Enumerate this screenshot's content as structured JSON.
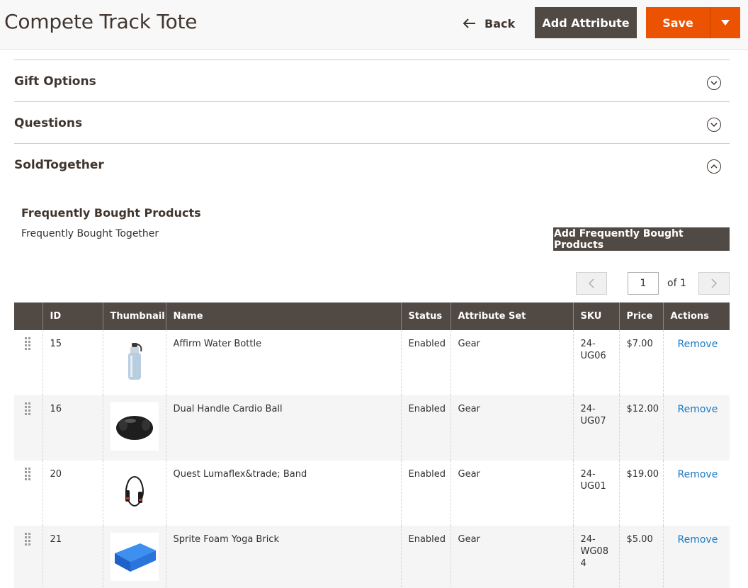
{
  "header": {
    "title": "Compete Track Tote",
    "back_label": "Back",
    "add_attribute_label": "Add Attribute",
    "save_label": "Save"
  },
  "sections": [
    {
      "title": "Gift Options",
      "state": "collapsed"
    },
    {
      "title": "Questions",
      "state": "collapsed"
    },
    {
      "title": "SoldTogether",
      "state": "expanded"
    }
  ],
  "sold_together": {
    "heading": "Frequently Bought Products",
    "subtext": "Frequently Bought Together",
    "add_button_label": "Add Frequently Bought Products"
  },
  "pager": {
    "current_page": "1",
    "of_label": "of 1"
  },
  "table": {
    "columns": [
      "",
      "ID",
      "Thumbnail",
      "Name",
      "Status",
      "Attribute Set",
      "SKU",
      "Price",
      "Actions"
    ],
    "rows": [
      {
        "id": "15",
        "thumbnail": "water-bottle",
        "name": "Affirm Water Bottle",
        "status": "Enabled",
        "attribute_set": "Gear",
        "sku": "24-UG06",
        "price": "$7.00",
        "action": "Remove"
      },
      {
        "id": "16",
        "thumbnail": "cardio-ball",
        "name": "Dual Handle Cardio Ball",
        "status": "Enabled",
        "attribute_set": "Gear",
        "sku": "24-UG07",
        "price": "$12.00",
        "action": "Remove"
      },
      {
        "id": "20",
        "thumbnail": "jump-rope",
        "name": "Quest Lumaflex&trade; Band",
        "status": "Enabled",
        "attribute_set": "Gear",
        "sku": "24-UG01",
        "price": "$19.00",
        "action": "Remove"
      },
      {
        "id": "21",
        "thumbnail": "yoga-brick",
        "name": "Sprite Foam Yoga Brick",
        "status": "Enabled",
        "attribute_set": "Gear",
        "sku": "24-WG084",
        "price": "$5.00",
        "action": "Remove"
      }
    ]
  },
  "colors": {
    "accent_orange": "#eb5202",
    "dark_button": "#514943",
    "link_blue": "#1979c3"
  }
}
